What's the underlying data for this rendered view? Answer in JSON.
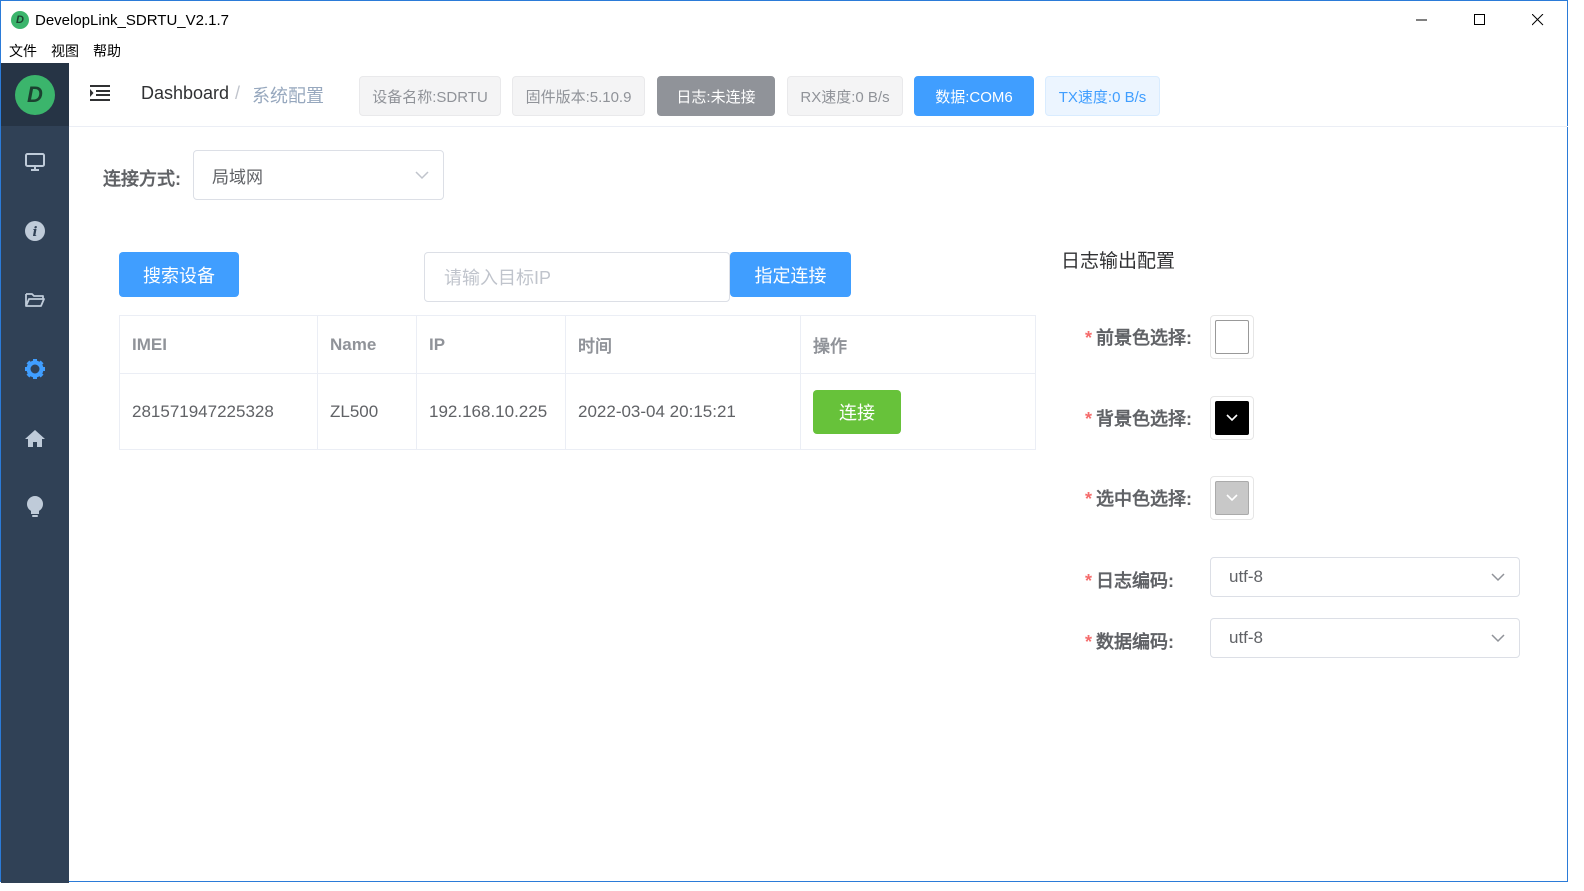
{
  "window": {
    "title": "DevelopLink_SDRTU_V2.1.7",
    "app_icon_letter": "D"
  },
  "menu": [
    "文件",
    "视图",
    "帮助"
  ],
  "sidebar": {
    "logo_letter": "D",
    "items": [
      {
        "icon": "monitor-icon",
        "active": false
      },
      {
        "icon": "info-icon",
        "active": false
      },
      {
        "icon": "folder-icon",
        "active": false
      },
      {
        "icon": "gear-icon",
        "active": true
      },
      {
        "icon": "home-icon",
        "active": false
      },
      {
        "icon": "lightbulb-icon",
        "active": false
      }
    ],
    "active_color": "#409eff"
  },
  "header": {
    "breadcrumb": [
      "Dashboard",
      "系统配置"
    ],
    "breadcrumb_sep": "/",
    "tags": {
      "device_name": "设备名称:SDRTU",
      "firmware": "固件版本:5.10.9",
      "log": "日志:未连接",
      "rx": "RX速度:0 B/s",
      "data": "数据:COM6",
      "tx": "TX速度:0 B/s"
    }
  },
  "connection": {
    "label": "连接方式:",
    "value": "局域网"
  },
  "actions": {
    "search_button": "搜索设备",
    "ip_placeholder": "请输入目标IP",
    "connect_specific_button": "指定连接"
  },
  "table": {
    "columns": [
      "IMEI",
      "Name",
      "IP",
      "时间",
      "操作"
    ],
    "rows": [
      {
        "imei": "281571947225328",
        "name": "ZL500",
        "ip": "192.168.10.225",
        "time": "2022-03-04 20:15:21",
        "action": "连接"
      }
    ]
  },
  "log_config": {
    "title": "日志输出配置",
    "required_mark": "*",
    "fg_label": "前景色选择:",
    "fg_color": "#ffffff",
    "bg_label": "背景色选择:",
    "bg_color": "#000000",
    "sel_label": "选中色选择:",
    "sel_color": "#c8c8c8",
    "log_encoding_label": "日志编码:",
    "log_encoding_value": "utf-8",
    "data_encoding_label": "数据编码:",
    "data_encoding_value": "utf-8"
  }
}
